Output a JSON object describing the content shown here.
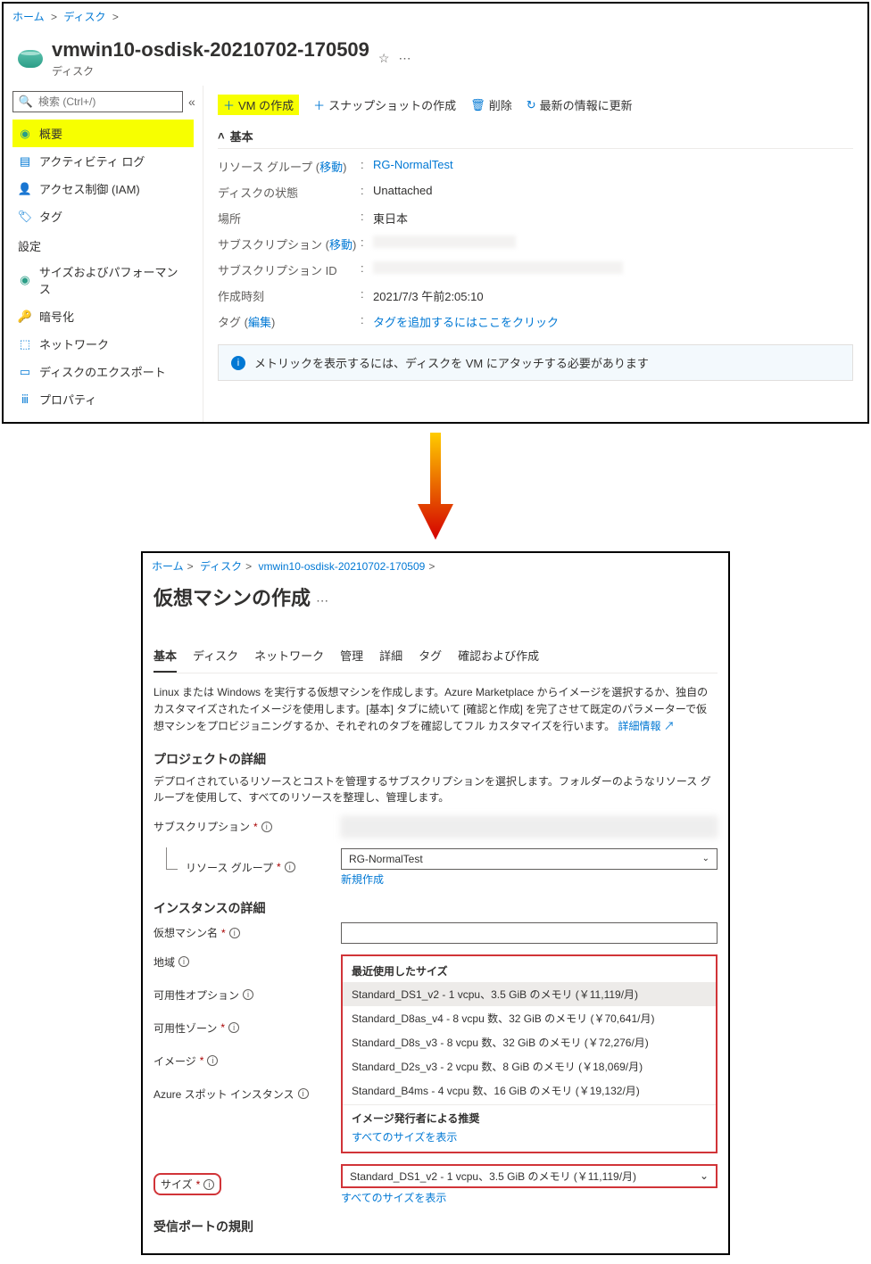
{
  "top": {
    "breadcrumb": {
      "home": "ホーム",
      "disk": "ディスク"
    },
    "title": "vmwin10-osdisk-20210702-170509",
    "subtitle": "ディスク",
    "search_placeholder": "検索 (Ctrl+/)",
    "nav": {
      "overview": "概要",
      "activity": "アクティビティ ログ",
      "iam": "アクセス制御 (IAM)",
      "tags": "タグ",
      "settings": "設定",
      "sizeperf": "サイズおよびパフォーマンス",
      "encryption": "暗号化",
      "network": "ネットワーク",
      "export": "ディスクのエクスポート",
      "properties": "プロパティ"
    },
    "toolbar": {
      "create_vm": "VM の作成",
      "snapshot": "スナップショットの作成",
      "delete": "削除",
      "refresh": "最新の情報に更新"
    },
    "section_basic": "基本",
    "props": {
      "rg_label": "リソース グループ",
      "rg_move": "移動",
      "rg_value": "RG-NormalTest",
      "state_label": "ディスクの状態",
      "state_value": "Unattached",
      "loc_label": "場所",
      "loc_value": "東日本",
      "sub_label": "サブスクリプション",
      "sub_move": "移動",
      "subid_label": "サブスクリプション ID",
      "created_label": "作成時刻",
      "created_value": "2021/7/3 午前2:05:10",
      "tags_label": "タグ",
      "tags_edit": "編集",
      "tags_value": "タグを追加するにはここをクリック"
    },
    "alert": "メトリックを表示するには、ディスクを VM にアタッチする必要があります"
  },
  "bottom": {
    "breadcrumb": {
      "home": "ホーム",
      "disk": "ディスク",
      "diskname": "vmwin10-osdisk-20210702-170509"
    },
    "title": "仮想マシンの作成",
    "tabs": {
      "basic": "基本",
      "disk": "ディスク",
      "network": "ネットワーク",
      "manage": "管理",
      "detail": "詳細",
      "tags": "タグ",
      "review": "確認および作成"
    },
    "desc": "Linux または Windows を実行する仮想マシンを作成します。Azure Marketplace からイメージを選択するか、独自のカスタマイズされたイメージを使用します。[基本] タブに続いて [確認と作成] を完了させて既定のパラメーターで仮想マシンをプロビジョニングするか、それぞれのタブを確認してフル カスタマイズを行います。",
    "desc_link": "詳細情報",
    "project_h": "プロジェクトの詳細",
    "project_desc": "デプロイされているリソースとコストを管理するサブスクリプションを選択します。フォルダーのようなリソース グループを使用して、すべてのリソースを整理し、管理します。",
    "sub_label": "サブスクリプション",
    "rg_label": "リソース グループ",
    "rg_value": "RG-NormalTest",
    "rg_new": "新規作成",
    "instance_h": "インスタンスの詳細",
    "vmname_label": "仮想マシン名",
    "region_label": "地域",
    "avail_label": "可用性オプション",
    "zone_label": "可用性ゾーン",
    "image_label": "イメージ",
    "spot_label": "Azure スポット インスタンス",
    "size_label": "サイズ",
    "dd_recent": "最近使用したサイズ",
    "dd_items": {
      "i1": "Standard_DS1_v2 - 1 vcpu、3.5 GiB のメモリ (￥11,119/月)",
      "i2": "Standard_D8as_v4 - 8 vcpu 数、32 GiB のメモリ (￥70,641/月)",
      "i3": "Standard_D8s_v3 - 8 vcpu 数、32 GiB のメモリ (￥72,276/月)",
      "i4": "Standard_D2s_v3 - 2 vcpu 数、8 GiB のメモリ (￥18,069/月)",
      "i5": "Standard_B4ms - 4 vcpu 数、16 GiB のメモリ (￥19,132/月)"
    },
    "dd_reco": "イメージ発行者による推奨",
    "all_sizes": "すべてのサイズを表示",
    "size_value": "Standard_DS1_v2 - 1 vcpu、3.5 GiB のメモリ (￥11,119/月)",
    "ports_h": "受信ポートの規則"
  }
}
